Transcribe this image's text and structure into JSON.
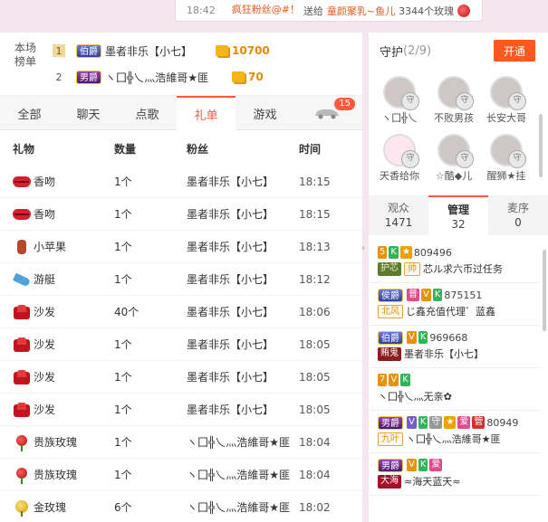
{
  "ticker": {
    "time": "18:42",
    "user": "疯狂粉丝@#！",
    "verb": "送给",
    "target": "童颜聚乳~鱼儿",
    "gift_text": "3344个玫瑰"
  },
  "rank": {
    "title_line1": "本场",
    "title_line2": "榜单",
    "entries": [
      {
        "num": "1",
        "noble": "伯爵",
        "name": "墨者非乐【小七】",
        "value": "10700"
      },
      {
        "num": "2",
        "noble": "男爵",
        "name": "ヽ囗╬乀灬浩維哥★匪",
        "value": "70"
      }
    ]
  },
  "tabs": [
    "全部",
    "聊天",
    "点歌",
    "礼单",
    "游戏"
  ],
  "active_tab": "礼单",
  "car_count": "15",
  "table": {
    "headers": {
      "gift": "礼物",
      "qty": "数量",
      "fan": "粉丝",
      "time": "时间"
    },
    "rows": [
      {
        "icon": "kiss-icon",
        "gift": "香吻",
        "qty": "1个",
        "fan": "墨者非乐【小七】",
        "time": "18:15"
      },
      {
        "icon": "kiss-icon",
        "gift": "香吻",
        "qty": "1个",
        "fan": "墨者非乐【小七】",
        "time": "18:15"
      },
      {
        "icon": "apple-icon",
        "gift": "小苹果",
        "qty": "1个",
        "fan": "墨者非乐【小七】",
        "time": "18:13"
      },
      {
        "icon": "boat-icon",
        "gift": "游艇",
        "qty": "1个",
        "fan": "墨者非乐【小七】",
        "time": "18:12"
      },
      {
        "icon": "sofa-icon",
        "gift": "沙发",
        "qty": "40个",
        "fan": "墨者非乐【小七】",
        "time": "18:06"
      },
      {
        "icon": "sofa-icon",
        "gift": "沙发",
        "qty": "1个",
        "fan": "墨者非乐【小七】",
        "time": "18:05"
      },
      {
        "icon": "sofa-icon",
        "gift": "沙发",
        "qty": "1个",
        "fan": "墨者非乐【小七】",
        "time": "18:05"
      },
      {
        "icon": "sofa-icon",
        "gift": "沙发",
        "qty": "1个",
        "fan": "墨者非乐【小七】",
        "time": "18:05"
      },
      {
        "icon": "rose-icon",
        "gift": "贵族玫瑰",
        "qty": "1个",
        "fan": "ヽ囗╬乀灬浩維哥★匪",
        "time": "18:04"
      },
      {
        "icon": "rose-icon",
        "gift": "贵族玫瑰",
        "qty": "1个",
        "fan": "ヽ囗╬乀灬浩維哥★匪",
        "time": "18:04"
      },
      {
        "icon": "gold-rose-icon",
        "gift": "金玫瑰",
        "qty": "6个",
        "fan": "ヽ囗╬乀灬浩維哥★匪",
        "time": "18:02"
      }
    ]
  },
  "guard": {
    "title": "守护",
    "count": "(2/9)",
    "open_label": "开通",
    "members": [
      {
        "name": "ヽ囗╬乀"
      },
      {
        "name": "不败男孩"
      },
      {
        "name": "长安大哥"
      },
      {
        "name": "天香给你"
      },
      {
        "name": "☆酷◆儿"
      },
      {
        "name": "醒狮★挂"
      }
    ]
  },
  "sub_tabs": [
    {
      "label": "观众",
      "count": "1471"
    },
    {
      "label": "管理",
      "count": "32"
    },
    {
      "label": "麦序",
      "count": "0"
    }
  ],
  "users": [
    {
      "level": "5",
      "badges": [
        "K",
        "★"
      ],
      "id": "809496",
      "tag": "护芯",
      "tag2": "帅",
      "name": "芯ル求六币过任务"
    },
    {
      "noble": "侯爵",
      "badges": [
        "普",
        "V",
        "K"
      ],
      "id": "875151",
      "tag": "北风",
      "name": "じ鑫充值代理゛蓝鑫"
    },
    {
      "noble": "伯爵",
      "badges": [
        "V",
        "K"
      ],
      "id": "969668",
      "tag": "贿鬼",
      "name": "墨者非乐【小七】"
    },
    {
      "level": "7",
      "badges": [
        "V",
        "K"
      ],
      "id": "",
      "tag": "",
      "name": "ヽ囗╬乀灬无亲✿"
    },
    {
      "noble": "男爵",
      "badges": [
        "V",
        "K",
        "守",
        "★",
        "爱",
        "管"
      ],
      "id": "80949",
      "tag": "九叶",
      "name": "ヽ囗╬乀灬浩維哥★匪"
    },
    {
      "noble": "男爵",
      "badges": [
        "V",
        "K",
        "爱"
      ],
      "id": "",
      "tag": "大海",
      "name": "≈海天蓝天≈"
    }
  ],
  "colors": {
    "accent": "#ff5a3c",
    "coin": "#f3b51a",
    "value": "#e88a00"
  }
}
